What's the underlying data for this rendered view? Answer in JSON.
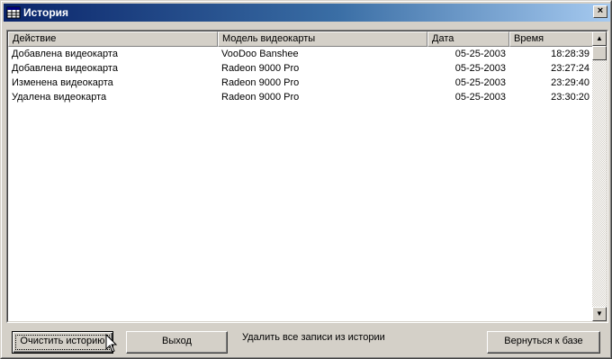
{
  "window": {
    "title": "История",
    "close_glyph": "×"
  },
  "table": {
    "columns": [
      "Действие",
      "Модель видеокарты",
      "Дата",
      "Время"
    ],
    "rows": [
      [
        "Добавлена видеокарта",
        "VooDoo Banshee",
        "05-25-2003",
        "18:28:39"
      ],
      [
        "Добавлена видеокарта",
        "Radeon 9000 Pro",
        "05-25-2003",
        "23:27:24"
      ],
      [
        "Изменена видеокарта",
        "Radeon 9000 Pro",
        "05-25-2003",
        "23:29:40"
      ],
      [
        "Удалена видеокарта",
        "Radeon 9000 Pro",
        "05-25-2003",
        "23:30:20"
      ]
    ]
  },
  "scrollbar": {
    "up_glyph": "▲",
    "down_glyph": "▼"
  },
  "footer": {
    "clear_label": "Очистить историю",
    "exit_label": "Выход",
    "status_text": "Удалить все записи из истории",
    "back_label": "Вернуться к базе"
  },
  "icons": {
    "window_icon": "table-grid-icon",
    "cursor": "mouse-pointer-icon"
  }
}
